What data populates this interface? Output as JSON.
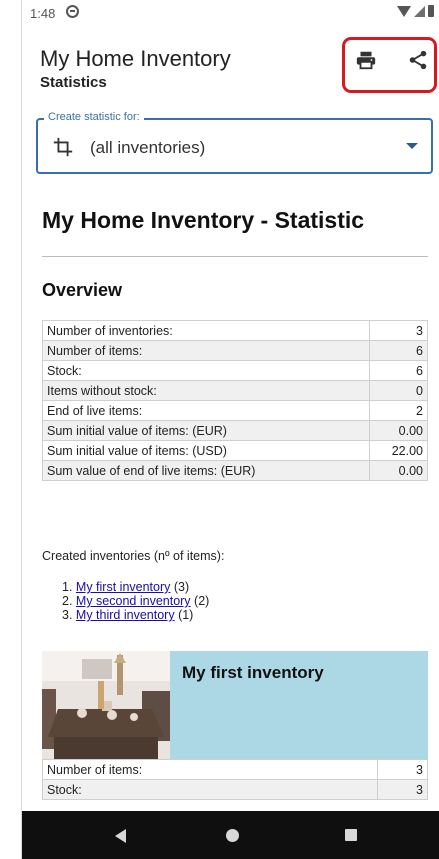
{
  "status_bar": {
    "time": "1:48"
  },
  "app_bar": {
    "title": "My Home Inventory",
    "subtitle": "Statistics",
    "actions": [
      "print-icon",
      "share-icon"
    ]
  },
  "selector": {
    "label": "Create statistic for:",
    "value": "(all inventories)"
  },
  "report": {
    "title": "My Home Inventory - Statistic",
    "overview_title": "Overview",
    "overview_rows": [
      {
        "label": "Number of inventories:",
        "value": "3"
      },
      {
        "label": "Number of items:",
        "value": "6"
      },
      {
        "label": "Stock:",
        "value": "6"
      },
      {
        "label": "Items without stock:",
        "value": "0"
      },
      {
        "label": "End of live items:",
        "value": "2"
      },
      {
        "label": "Sum initial value of items: (EUR)",
        "value": "0.00"
      },
      {
        "label": "Sum initial value of items: (USD)",
        "value": "22.00"
      },
      {
        "label": "Sum value of end of live items: (EUR)",
        "value": "0.00"
      }
    ],
    "created_caption": "Created inventories (nº of items):",
    "inventories": [
      {
        "num": "1.",
        "name": "My first inventory",
        "count": "(3)"
      },
      {
        "num": "2.",
        "name": "My second inventory",
        "count": "(2)"
      },
      {
        "num": "3.",
        "name": "My third inventory",
        "count": "(1)"
      }
    ],
    "card": {
      "title": "My first inventory",
      "rows": [
        {
          "label": "Number of items:",
          "value": "3"
        },
        {
          "label": "Stock:",
          "value": "3"
        }
      ]
    }
  },
  "colors": {
    "accent": "#3a6fa8",
    "highlight_box": "#d71920",
    "card_bg": "#acd8e6",
    "link": "#1a0dab",
    "nav_bar": "#0f0f0f"
  }
}
